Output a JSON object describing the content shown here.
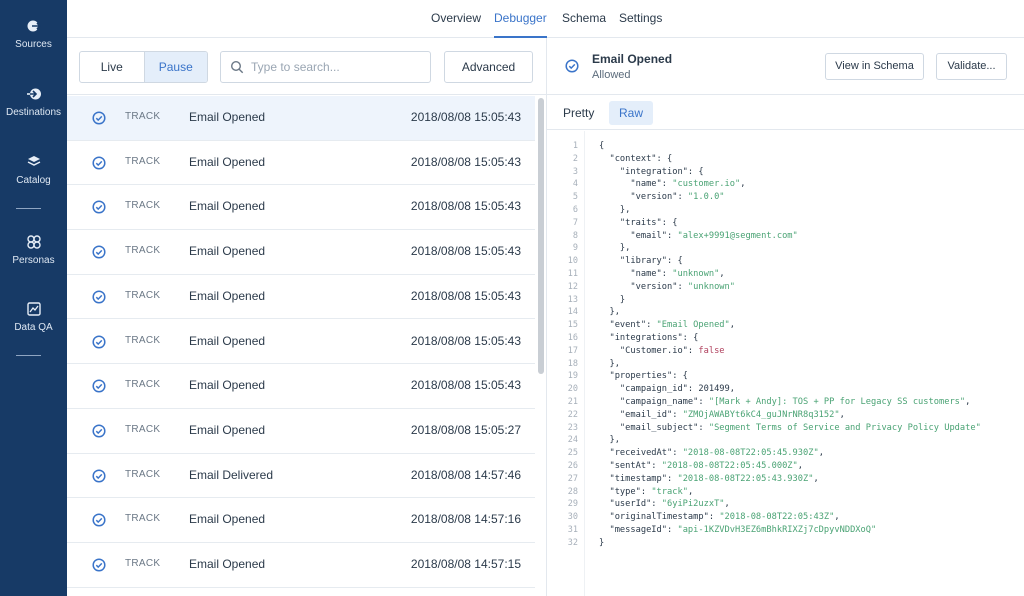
{
  "sidebar": {
    "items": [
      {
        "label": "Sources",
        "icon": "sources-icon"
      },
      {
        "label": "Destinations",
        "icon": "destinations-icon"
      },
      {
        "label": "Catalog",
        "icon": "catalog-icon"
      },
      {
        "label": "Personas",
        "icon": "personas-icon"
      },
      {
        "label": "Data QA",
        "icon": "data-qa-icon"
      }
    ]
  },
  "topnav": {
    "tabs": [
      {
        "label": "Overview"
      },
      {
        "label": "Debugger"
      },
      {
        "label": "Schema"
      },
      {
        "label": "Settings"
      }
    ],
    "active": "Debugger"
  },
  "toolbar": {
    "live_label": "Live",
    "pause_label": "Pause",
    "search_placeholder": "Type to search...",
    "advanced_label": "Advanced"
  },
  "events": [
    {
      "type": "TRACK",
      "name": "Email Opened",
      "time": "2018/08/08 15:05:43"
    },
    {
      "type": "TRACK",
      "name": "Email Opened",
      "time": "2018/08/08 15:05:43"
    },
    {
      "type": "TRACK",
      "name": "Email Opened",
      "time": "2018/08/08 15:05:43"
    },
    {
      "type": "TRACK",
      "name": "Email Opened",
      "time": "2018/08/08 15:05:43"
    },
    {
      "type": "TRACK",
      "name": "Email Opened",
      "time": "2018/08/08 15:05:43"
    },
    {
      "type": "TRACK",
      "name": "Email Opened",
      "time": "2018/08/08 15:05:43"
    },
    {
      "type": "TRACK",
      "name": "Email Opened",
      "time": "2018/08/08 15:05:43"
    },
    {
      "type": "TRACK",
      "name": "Email Opened",
      "time": "2018/08/08 15:05:27"
    },
    {
      "type": "TRACK",
      "name": "Email Delivered",
      "time": "2018/08/08 14:57:46"
    },
    {
      "type": "TRACK",
      "name": "Email Opened",
      "time": "2018/08/08 14:57:16"
    },
    {
      "type": "TRACK",
      "name": "Email Opened",
      "time": "2018/08/08 14:57:15"
    }
  ],
  "detail": {
    "title": "Email Opened",
    "status": "Allowed",
    "view_schema_label": "View in Schema",
    "validate_label": "Validate...",
    "pretty_label": "Pretty",
    "raw_label": "Raw"
  },
  "code_lines": [
    "{",
    "  \"context\": {",
    "    \"integration\": {",
    "      \"name\": \"customer.io\",",
    "      \"version\": \"1.0.0\"",
    "    },",
    "    \"traits\": {",
    "      \"email\": \"alex+9991@segment.com\"",
    "    },",
    "    \"library\": {",
    "      \"name\": \"unknown\",",
    "      \"version\": \"unknown\"",
    "    }",
    "  },",
    "  \"event\": \"Email Opened\",",
    "  \"integrations\": {",
    "    \"Customer.io\": false",
    "  },",
    "  \"properties\": {",
    "    \"campaign_id\": 201499,",
    "    \"campaign_name\": \"[Mark + Andy]: TOS + PP for Legacy SS customers\",",
    "    \"email_id\": \"ZMOjAWABYt6kC4_guJNrNR8q3152\",",
    "    \"email_subject\": \"Segment Terms of Service and Privacy Policy Update\"",
    "  },",
    "  \"receivedAt\": \"2018-08-08T22:05:45.930Z\",",
    "  \"sentAt\": \"2018-08-08T22:05:45.000Z\",",
    "  \"timestamp\": \"2018-08-08T22:05:43.930Z\",",
    "  \"type\": \"track\",",
    "  \"userId\": \"6yiPi2uzxT\",",
    "  \"originalTimestamp\": \"2018-08-08T22:05:43Z\",",
    "  \"messageId\": \"api-1KZVDvH3EZ6mBhkRIXZj7cDpyvNDDXoQ\"",
    "}"
  ],
  "colors": {
    "sidebar": "#173a66",
    "accent": "#3a74c9",
    "string": "#4aa374",
    "keyword": "#b0415e"
  }
}
